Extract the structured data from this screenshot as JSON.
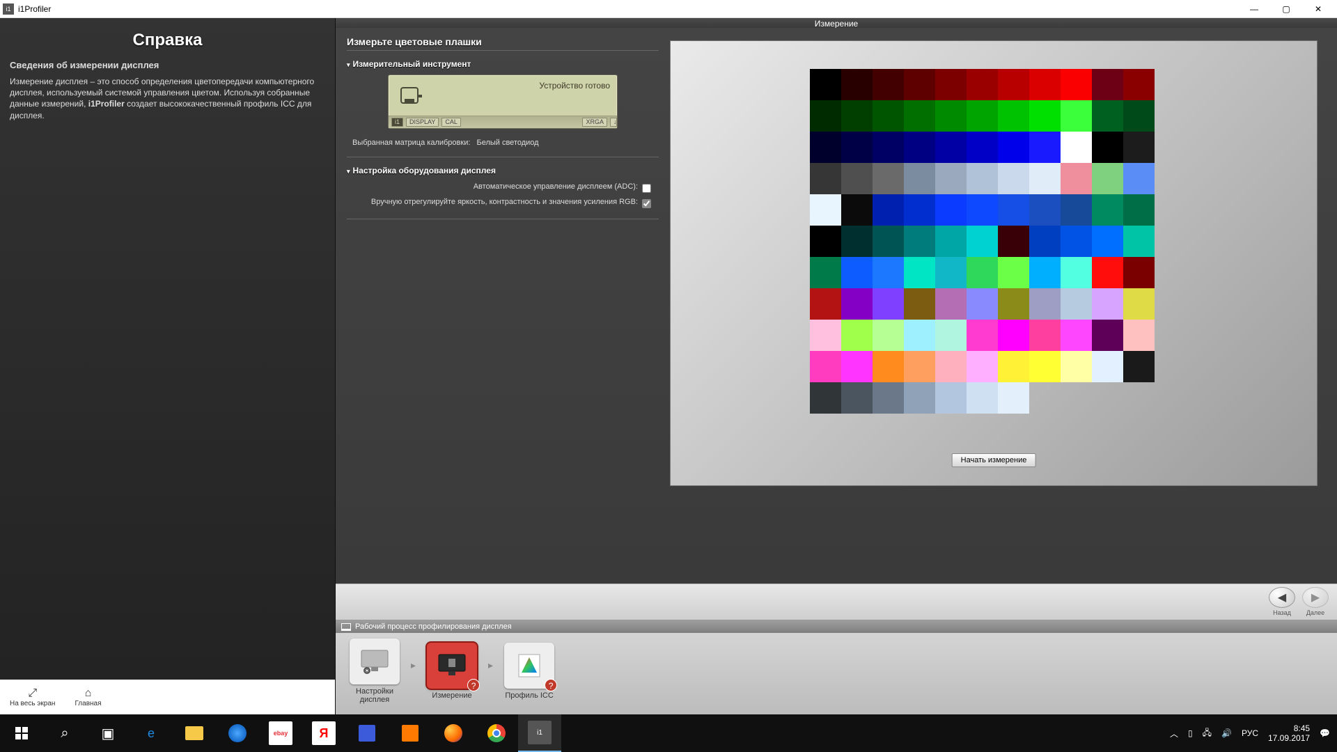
{
  "titlebar": {
    "app_name": "i1Profiler"
  },
  "help": {
    "title": "Справка",
    "subtitle": "Сведения об измерении дисплея",
    "body_prefix": "Измерение дисплея – это способ определения цветопередачи компьютерного дисплея, используемый системой управления цветом. Используя собранные данные измерений, ",
    "body_bold": "i1Profiler",
    "body_suffix": " создает высококачественный профиль ICC для дисплея.",
    "bottom": {
      "fullscreen": "На весь экран",
      "home": "Главная"
    }
  },
  "workspace": {
    "header": "Измерение",
    "main_heading": "Измерьте цветовые плашки",
    "section_instrument": "Измерительный инструмент",
    "device": {
      "status": "Устройство готово",
      "tag_i1": "i1",
      "tag_display": "DISPLAY",
      "tag_cal": "CAL",
      "tag_xrga": "XRGA"
    },
    "matrix_label": "Выбранная матрица калибровки:",
    "matrix_value": "Белый светодиод",
    "section_hw": "Настройка оборудования дисплея",
    "opt_adc": "Автоматическое управление дисплеем (ADC):",
    "opt_manual": "Вручную отрегулируйте яркость, контрастность и значения усиления RGB:",
    "start_button": "Начать измерение"
  },
  "nav": {
    "back": "Назад",
    "next": "Далее"
  },
  "workflow": {
    "title": "Рабочий процесс профилирования дисплея",
    "step1": "Настройки дисплея",
    "step2": "Измерение",
    "step3": "Профиль ICC"
  },
  "taskbar": {
    "lang": "РУС",
    "time": "8:45",
    "date": "17.09.2017"
  },
  "patches": [
    "#000000",
    "#280000",
    "#420000",
    "#5e0000",
    "#7c0000",
    "#9a0000",
    "#b90000",
    "#da0000",
    "#fa0000",
    "#6d0015",
    "#8a0000",
    "#002a00",
    "#003f00",
    "#005600",
    "#006f00",
    "#008a00",
    "#00a400",
    "#00c200",
    "#00e000",
    "#3cff3c",
    "#006020",
    "#004a1a",
    "#00002c",
    "#000047",
    "#000064",
    "#000083",
    "#0000a4",
    "#0000c6",
    "#0000eb",
    "#1a1aff",
    "#ffffff",
    "#000000",
    "#1c1c1c",
    "#363636",
    "#4f4f4f",
    "#6a6a6a",
    "#7b8ca0",
    "#9aa9bd",
    "#b0c2d8",
    "#cad9ec",
    "#e0edf9",
    "#ef8f9d",
    "#7fd07f",
    "#5a8df5",
    "#e8f5ff",
    "#0b0b0b",
    "#0020b0",
    "#002ecf",
    "#0b3bff",
    "#0f49ff",
    "#164fe6",
    "#1b4fc0",
    "#174a99",
    "#008a5f",
    "#006e46",
    "#000000",
    "#002f2f",
    "#005454",
    "#007c7c",
    "#00a6a6",
    "#00d1d1",
    "#3a0008",
    "#0040c0",
    "#0053e5",
    "#006fff",
    "#00c4a6",
    "#007a48",
    "#0d5cff",
    "#1c78ff",
    "#00e6c5",
    "#12b7c7",
    "#2fd75a",
    "#6cff48",
    "#00b0ff",
    "#52ffe1",
    "#ff0d0d",
    "#7a0000",
    "#b41313",
    "#8400c4",
    "#8040ff",
    "#7b5c11",
    "#b46fb4",
    "#8a8aff",
    "#8b8b1a",
    "#9e9ec4",
    "#b7cbe0",
    "#d7a4ff",
    "#dedb46",
    "#ffc0e0",
    "#9fff4a",
    "#b6ff95",
    "#9ff0ff",
    "#b0f5e0",
    "#ff3ccf",
    "#ff00ff",
    "#ff3fa0",
    "#ff46ff",
    "#5e0058",
    "#ffc0c0",
    "#ff3cc0",
    "#ff34ff",
    "#ff8b1f",
    "#ff9f5f",
    "#ffb0bf",
    "#ffafff",
    "#fff236",
    "#ffff33",
    "#ffffa5",
    "#e3f0ff",
    "#1a1a1a",
    "#303638",
    "#4a5560",
    "#6a788a",
    "#90a2b8",
    "#b3c6df",
    "#cfe0f3",
    "#e3f0fb"
  ]
}
